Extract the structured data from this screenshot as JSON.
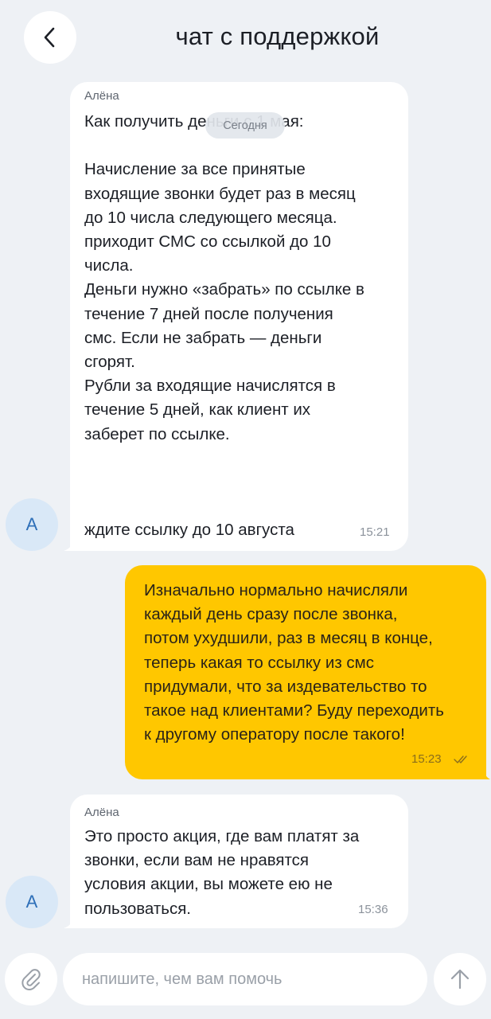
{
  "header": {
    "title": "чат с поддержкой"
  },
  "date_separator": "Сегодня",
  "messages": [
    {
      "direction": "incoming",
      "sender": "Алёна",
      "avatar_letter": "А",
      "text": "Как получить деньги с 1 мая:\n\nНачисление за все принятые\nвходящие звонки будет раз в месяц\nдо 10 числа следующего месяца.\n приходит СМС со ссылкой до 10\nчисла.\nДеньги нужно «забрать» по ссылке в\nтечение 7 дней после получения\nсмс. Если не забрать — деньги\nсгорят.\nРубли за входящие начислятся в\nтечение 5 дней, как клиент их\nзаберет по ссылке.\n\n\n\nждите ссылку до 10 августа",
      "time": "15:21"
    },
    {
      "direction": "outgoing",
      "text": "Изначально нормально начисляли\nкаждый день сразу после звонка,\nпотом ухудшили, раз в месяц в конце,\nтеперь какая то ссылку из смс\nпридумали, что за издевательство то\nтакое над клиентами? Буду переходить\nк другому оператору после такого!",
      "time": "15:23",
      "status_icon": "double-check-icon"
    },
    {
      "direction": "incoming",
      "sender": "Алёна",
      "avatar_letter": "А",
      "text": "Это просто акция, где вам платят за\nзвонки, если вам не нравятся\nусловия акции, вы можете ею не\nпользоваться.",
      "time": "15:36"
    }
  ],
  "composer": {
    "placeholder": "напишите, чем вам помочь",
    "attach_icon": "paperclip-icon",
    "send_icon": "arrow-up-icon"
  },
  "colors": {
    "background": "#eef1f5",
    "outgoing_bubble": "#ffc700",
    "incoming_bubble": "#ffffff",
    "avatar_bg": "#d9e8f7",
    "avatar_text": "#2e6fb8"
  }
}
